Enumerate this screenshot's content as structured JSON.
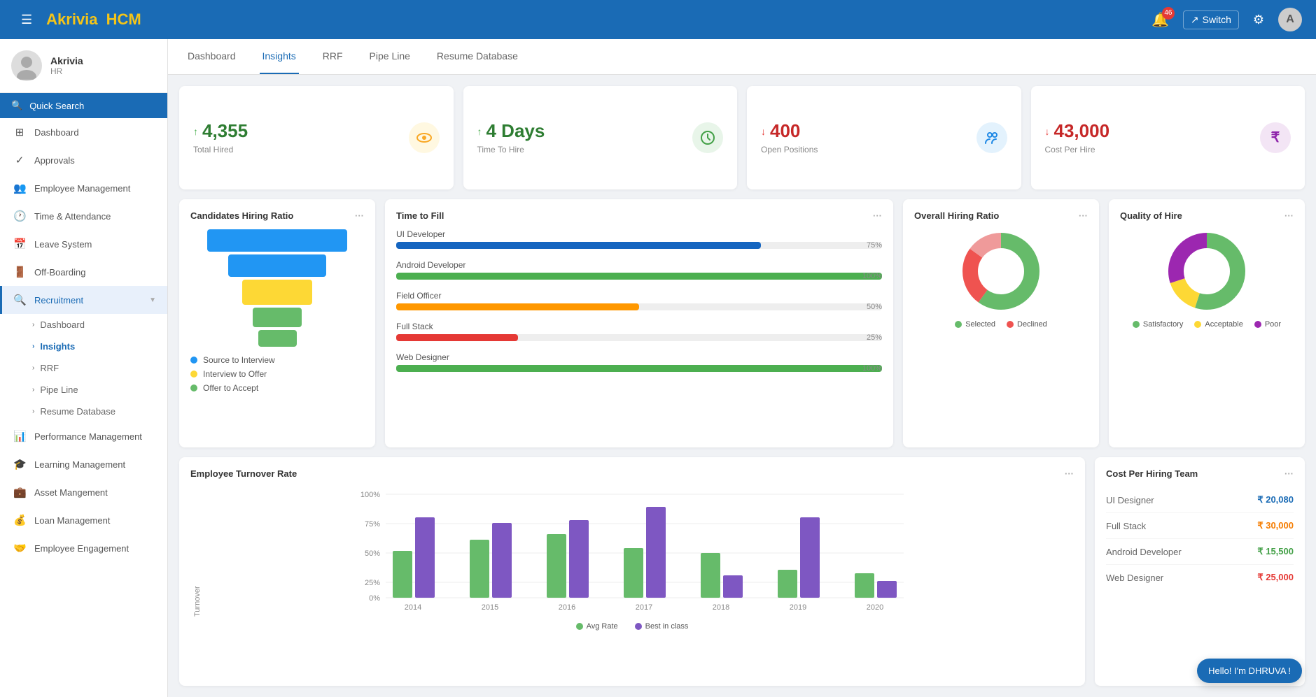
{
  "header": {
    "logo_text": "Akrivia",
    "logo_accent": "HCM",
    "bell_count": "46",
    "switch_label": "Switch",
    "avatar_initials": "A"
  },
  "sidebar": {
    "profile": {
      "name": "Akrivia",
      "role": "HR"
    },
    "search_label": "Quick Search",
    "nav_items": [
      {
        "id": "dashboard",
        "label": "Dashboard",
        "icon": "⊞"
      },
      {
        "id": "approvals",
        "label": "Approvals",
        "icon": "✓"
      },
      {
        "id": "employee-management",
        "label": "Employee Management",
        "icon": "👥"
      },
      {
        "id": "time-attendance",
        "label": "Time & Attendance",
        "icon": "🕐"
      },
      {
        "id": "leave-system",
        "label": "Leave System",
        "icon": "📅"
      },
      {
        "id": "off-boarding",
        "label": "Off-Boarding",
        "icon": "🚪"
      },
      {
        "id": "recruitment",
        "label": "Recruitment",
        "icon": "🔍",
        "active": true
      },
      {
        "id": "performance-management",
        "label": "Performance Management",
        "icon": "📊"
      },
      {
        "id": "learning-management",
        "label": "Learning Management",
        "icon": "🎓"
      },
      {
        "id": "asset-management",
        "label": "Asset Mangement",
        "icon": "💼"
      },
      {
        "id": "loan-management",
        "label": "Loan Management",
        "icon": "💰"
      },
      {
        "id": "employee-engagement",
        "label": "Employee Engagement",
        "icon": "🤝"
      }
    ],
    "recruitment_sub": [
      {
        "id": "dashboard",
        "label": "Dashboard"
      },
      {
        "id": "insights",
        "label": "Insights",
        "active": true
      },
      {
        "id": "rrf",
        "label": "RRF"
      },
      {
        "id": "pipeline",
        "label": "Pipe Line"
      },
      {
        "id": "resume-database",
        "label": "Resume Database"
      }
    ]
  },
  "tabs": [
    {
      "id": "dashboard",
      "label": "Dashboard"
    },
    {
      "id": "insights",
      "label": "Insights",
      "active": true
    },
    {
      "id": "rrf",
      "label": "RRF"
    },
    {
      "id": "pipeline",
      "label": "Pipe Line"
    },
    {
      "id": "resume-database",
      "label": "Resume Database"
    }
  ],
  "stats": [
    {
      "id": "total-hired",
      "arrow": "up",
      "value": "4,355",
      "label": "Total Hired",
      "icon_type": "yellow",
      "icon": "👁"
    },
    {
      "id": "time-to-hire",
      "arrow": "up",
      "value": "4 Days",
      "label": "Time To Hire",
      "icon_type": "green",
      "icon": "⏱"
    },
    {
      "id": "open-positions",
      "arrow": "down",
      "value": "400",
      "label": "Open Positions",
      "icon_type": "blue",
      "icon": "👤"
    },
    {
      "id": "cost-per-hire",
      "arrow": "down",
      "value": "43,000",
      "label": "Cost Per Hire",
      "icon_type": "purple",
      "icon": "₹"
    }
  ],
  "candidates_hiring_ratio": {
    "title": "Candidates Hiring Ratio",
    "legend": [
      {
        "label": "Source to Interview",
        "color": "#2196f3"
      },
      {
        "label": "Interview to Offer",
        "color": "#fdd835"
      },
      {
        "label": "Offer to Accept",
        "color": "#66bb6a"
      }
    ]
  },
  "time_to_fill": {
    "title": "Time to Fill",
    "items": [
      {
        "label": "UI Developer",
        "pct": 75,
        "color": "#1565c0"
      },
      {
        "label": "Android Developer",
        "pct": 100,
        "color": "#4caf50"
      },
      {
        "label": "Field Officer",
        "pct": 50,
        "color": "#ff9800"
      },
      {
        "label": "Full Stack",
        "pct": 25,
        "color": "#e53935"
      },
      {
        "label": "Web Designer",
        "pct": 100,
        "color": "#4caf50"
      }
    ]
  },
  "overall_hiring_ratio": {
    "title": "Overall Hiring Ratio",
    "legend": [
      {
        "label": "Selected",
        "color": "#66bb6a"
      },
      {
        "label": "Declined",
        "color": "#ef5350"
      }
    ],
    "segments": [
      {
        "label": "Selected",
        "value": 60,
        "color": "#66bb6a"
      },
      {
        "label": "Declined",
        "value": 25,
        "color": "#ef5350"
      },
      {
        "label": "Other",
        "value": 15,
        "color": "#ef9a9a"
      }
    ]
  },
  "quality_of_hire": {
    "title": "Quality of Hire",
    "legend": [
      {
        "label": "Satisfactory",
        "color": "#66bb6a"
      },
      {
        "label": "Acceptable",
        "color": "#fdd835"
      },
      {
        "label": "Poor",
        "color": "#9c27b0"
      }
    ],
    "segments": [
      {
        "label": "Satisfactory",
        "value": 55,
        "color": "#66bb6a"
      },
      {
        "label": "Acceptable",
        "value": 15,
        "color": "#fdd835"
      },
      {
        "label": "Poor",
        "value": 30,
        "color": "#9c27b0"
      }
    ]
  },
  "employee_turnover": {
    "title": "Employee Turnover Rate",
    "y_labels": [
      "100%",
      "75%",
      "50%",
      "25%",
      "0%"
    ],
    "x_labels": [
      "2014",
      "2015",
      "2016",
      "2017",
      "2018",
      "2019",
      "2020"
    ],
    "legend": [
      {
        "label": "Avg Rate",
        "color": "#66bb6a"
      },
      {
        "label": "Best in class",
        "color": "#7e57c2"
      }
    ],
    "y_axis_label": "Turnover",
    "data": [
      {
        "year": "2014",
        "avg": 42,
        "best": 72
      },
      {
        "year": "2015",
        "avg": 55,
        "best": 68
      },
      {
        "year": "2016",
        "avg": 60,
        "best": 70
      },
      {
        "year": "2017",
        "avg": 45,
        "best": 82
      },
      {
        "year": "2018",
        "avg": 40,
        "best": 20
      },
      {
        "year": "2019",
        "avg": 25,
        "best": 72
      },
      {
        "year": "2020",
        "avg": 22,
        "best": 15
      }
    ]
  },
  "cost_per_hiring": {
    "title": "Cost Per Hiring Team",
    "items": [
      {
        "label": "UI Designer",
        "value": "₹ 20,080",
        "color_class": "blue"
      },
      {
        "label": "Full Stack",
        "value": "₹ 30,000",
        "color_class": "orange"
      },
      {
        "label": "Android Developer",
        "value": "₹ 15,500",
        "color_class": "green2"
      },
      {
        "label": "Web Designer",
        "value": "₹ 25,000",
        "color_class": "red2"
      }
    ]
  },
  "chat_bubble": {
    "label": "Hello! I'm DHRUVA !"
  }
}
